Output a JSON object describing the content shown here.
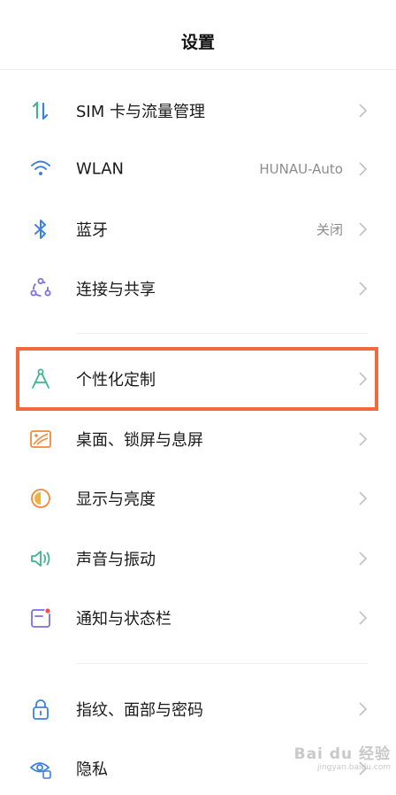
{
  "header": {
    "title": "设置"
  },
  "rows": [
    {
      "label": "SIM 卡与流量管理",
      "value": "",
      "icon": "sim-data-icon"
    },
    {
      "label": "WLAN",
      "value": "HUNAU-Auto",
      "icon": "wifi-icon"
    },
    {
      "label": "蓝牙",
      "value": "关闭",
      "icon": "bluetooth-icon"
    },
    {
      "label": "连接与共享",
      "value": "",
      "icon": "connection-share-icon"
    },
    {
      "label": "个性化定制",
      "value": "",
      "icon": "personalization-icon"
    },
    {
      "label": "桌面、锁屏与息屏",
      "value": "",
      "icon": "wallpaper-icon"
    },
    {
      "label": "显示与亮度",
      "value": "",
      "icon": "display-brightness-icon"
    },
    {
      "label": "声音与振动",
      "value": "",
      "icon": "sound-icon"
    },
    {
      "label": "通知与状态栏",
      "value": "",
      "icon": "notification-icon"
    },
    {
      "label": "指纹、面部与密码",
      "value": "",
      "icon": "lock-icon"
    },
    {
      "label": "隐私",
      "value": "",
      "icon": "privacy-icon"
    }
  ],
  "watermark": {
    "brand": "Bai du 经验",
    "url": "jingyan.baidu.com"
  },
  "colors": {
    "highlight": "#f06a3e",
    "chevron": "#c4c4c4"
  }
}
